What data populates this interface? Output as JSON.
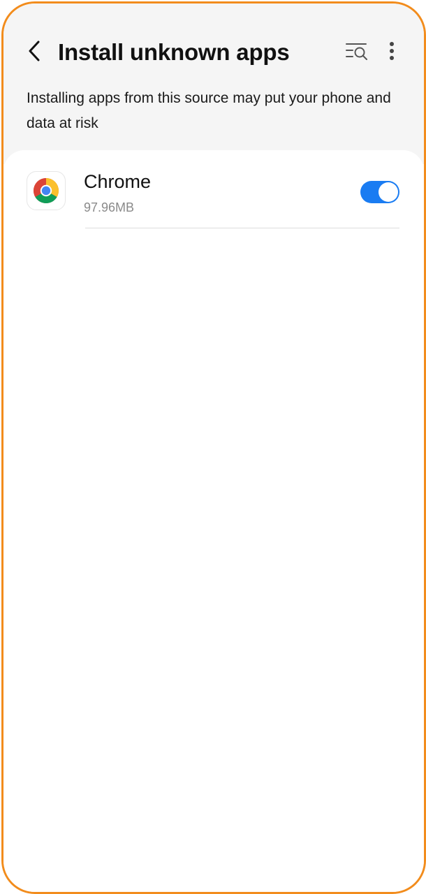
{
  "header": {
    "title": "Install unknown apps",
    "back_icon": "chevron-left-icon",
    "search_icon": "list-search-icon",
    "more_icon": "more-vertical-icon"
  },
  "warning": {
    "text": "Installing apps from this source may put your phone and data at risk"
  },
  "apps": [
    {
      "name": "Chrome",
      "size": "97.96MB",
      "icon": "chrome-icon",
      "allowed": true
    }
  ],
  "colors": {
    "toggle_on": "#1a7cf2",
    "frame": "#f28c1c",
    "top_background": "#f5f5f5"
  }
}
